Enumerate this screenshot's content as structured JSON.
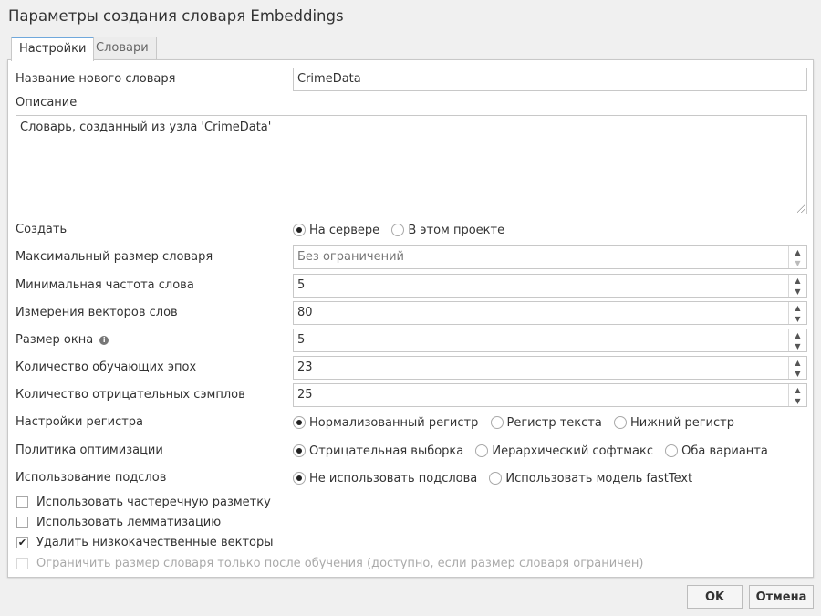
{
  "dialog": {
    "title": "Параметры создания словаря Embeddings"
  },
  "tabs": [
    {
      "label": "Настройки",
      "active": true
    },
    {
      "label": "Словари",
      "active": false
    }
  ],
  "form": {
    "name": {
      "label": "Название нового словаря",
      "value": "CrimeData"
    },
    "description": {
      "label": "Описание",
      "value": "Словарь, созданный из узла 'CrimeData'"
    },
    "create": {
      "label": "Создать",
      "options": [
        {
          "label": "На сервере",
          "checked": true
        },
        {
          "label": "В этом проекте",
          "checked": false
        }
      ]
    },
    "max_size": {
      "label": "Максимальный размер словаря",
      "placeholder": "Без ограничений"
    },
    "min_freq": {
      "label": "Минимальная частота слова",
      "value": "5"
    },
    "vector_dims": {
      "label": "Измерения векторов слов",
      "value": "80"
    },
    "window_size": {
      "label": "Размер окна",
      "info_icon": "info-icon",
      "value": "5"
    },
    "epochs": {
      "label": "Количество обучающих эпох",
      "value": "23"
    },
    "neg_samples": {
      "label": "Количество отрицательных сэмплов",
      "value": "25"
    },
    "case_settings": {
      "label": "Настройки регистра",
      "options": [
        {
          "label": "Нормализованный регистр",
          "checked": true
        },
        {
          "label": "Регистр текста",
          "checked": false
        },
        {
          "label": "Нижний регистр",
          "checked": false
        }
      ]
    },
    "optimization": {
      "label": "Политика оптимизации",
      "options": [
        {
          "label": "Отрицательная выборка",
          "checked": true
        },
        {
          "label": "Иерархический софтмакс",
          "checked": false
        },
        {
          "label": "Оба варианта",
          "checked": false
        }
      ]
    },
    "subwords": {
      "label": "Использование подслов",
      "options": [
        {
          "label": "Не использовать подслова",
          "checked": true
        },
        {
          "label": "Использовать модель fastText",
          "checked": false
        }
      ]
    },
    "checkboxes": [
      {
        "label": "Использовать частеречную разметку",
        "checked": false,
        "disabled": false
      },
      {
        "label": "Использовать лемматизацию",
        "checked": false,
        "disabled": false
      },
      {
        "label": "Удалить низкокачественные векторы",
        "checked": true,
        "disabled": false
      },
      {
        "label": "Ограничить размер словаря только после обучения (доступно, если размер словаря ограничен)",
        "checked": false,
        "disabled": true
      }
    ]
  },
  "buttons": {
    "ok": "OK",
    "cancel": "Отмена"
  }
}
